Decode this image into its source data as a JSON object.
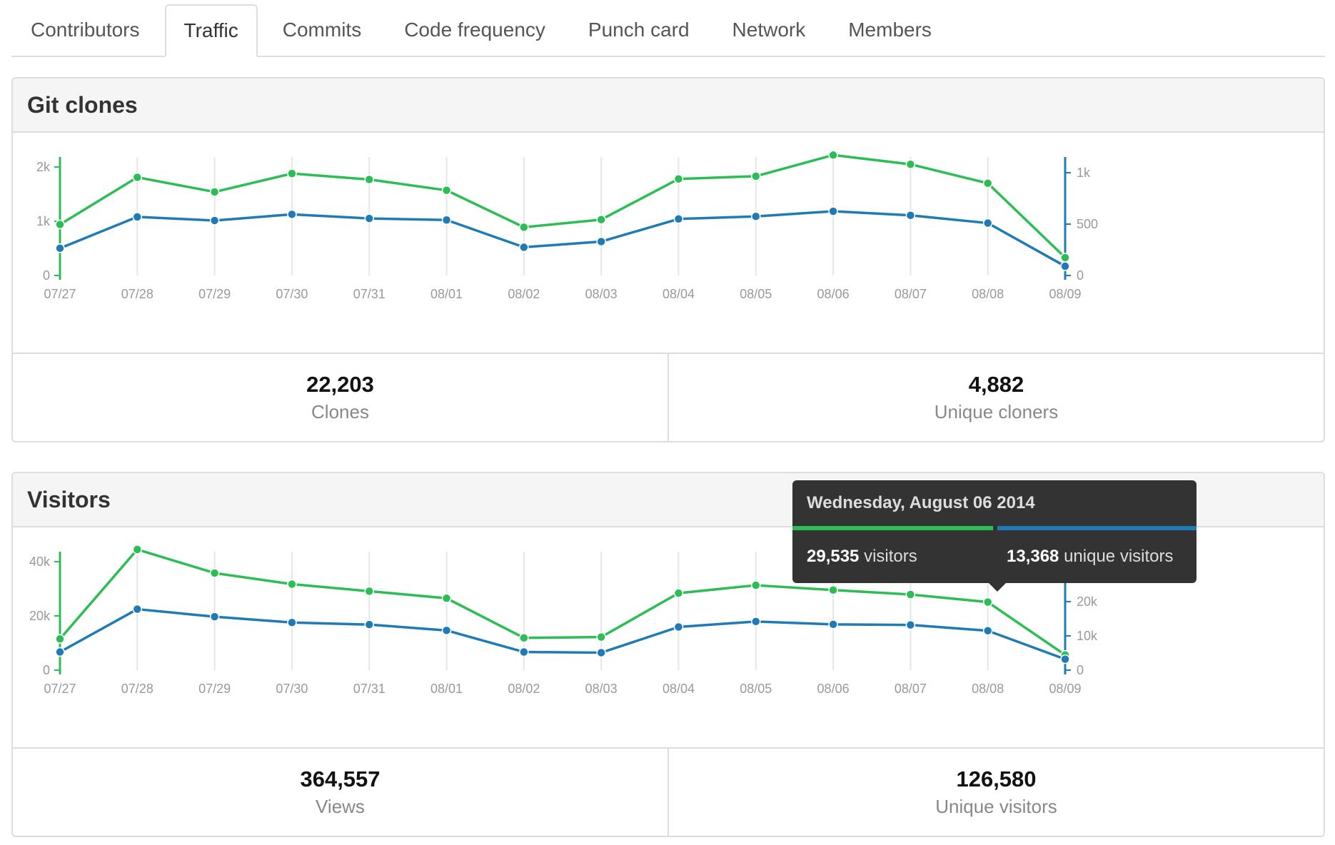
{
  "tabs": [
    {
      "label": "Contributors",
      "active": false
    },
    {
      "label": "Traffic",
      "active": true
    },
    {
      "label": "Commits",
      "active": false
    },
    {
      "label": "Code frequency",
      "active": false
    },
    {
      "label": "Punch card",
      "active": false
    },
    {
      "label": "Network",
      "active": false
    },
    {
      "label": "Members",
      "active": false
    }
  ],
  "colors": {
    "total": "#2cbd55",
    "unique": "#1f7bb5",
    "grid": "#e6e6e6",
    "axis_text": "#999999"
  },
  "clones": {
    "title": "Git clones",
    "stats": [
      {
        "value": "22,203",
        "label": "Clones"
      },
      {
        "value": "4,882",
        "label": "Unique cloners"
      }
    ]
  },
  "visitors": {
    "title": "Visitors",
    "stats": [
      {
        "value": "364,557",
        "label": "Views"
      },
      {
        "value": "126,580",
        "label": "Unique visitors"
      }
    ],
    "tooltip": {
      "date": "Wednesday, August 06 2014",
      "visitors_value": "29,535",
      "visitors_label": "visitors",
      "unique_value": "13,368",
      "unique_label": "unique visitors",
      "index": 10
    }
  },
  "chart_data": [
    {
      "type": "line",
      "title": "Git clones",
      "x": [
        "07/27",
        "07/28",
        "07/29",
        "07/30",
        "07/31",
        "08/01",
        "08/02",
        "08/03",
        "08/04",
        "08/05",
        "08/06",
        "08/07",
        "08/08",
        "08/09"
      ],
      "left_axis": {
        "ticks": [
          0,
          1000,
          2000
        ],
        "tick_labels": [
          "0",
          "1k",
          "2k"
        ],
        "ylim": [
          0,
          2000
        ]
      },
      "right_axis": {
        "ticks": [
          0,
          500,
          1000
        ],
        "tick_labels": [
          "0",
          "500",
          "1k"
        ],
        "ylim": [
          0,
          1000
        ]
      },
      "series": [
        {
          "axis": "left",
          "color": "#2cbd55",
          "values": [
            940,
            1810,
            1540,
            1880,
            1770,
            1570,
            890,
            1030,
            1780,
            1830,
            2220,
            2050,
            1700,
            330
          ]
        },
        {
          "axis": "right",
          "color": "#1f7bb5",
          "values": [
            265,
            570,
            535,
            595,
            555,
            540,
            275,
            330,
            550,
            575,
            625,
            585,
            510,
            90
          ]
        }
      ],
      "grid": true
    },
    {
      "type": "line",
      "title": "Visitors",
      "x": [
        "07/27",
        "07/28",
        "07/29",
        "07/30",
        "07/31",
        "08/01",
        "08/02",
        "08/03",
        "08/04",
        "08/05",
        "08/06",
        "08/07",
        "08/08",
        "08/09"
      ],
      "left_axis": {
        "ticks": [
          0,
          20000,
          40000
        ],
        "tick_labels": [
          "0",
          "20k",
          "40k"
        ],
        "ylim": [
          0,
          40000
        ]
      },
      "right_axis": {
        "ticks": [
          0,
          10000,
          20000,
          30000
        ],
        "tick_labels": [
          "0",
          "10k",
          "20k",
          "30k"
        ],
        "ylim": [
          0,
          30000
        ]
      },
      "series": [
        {
          "axis": "left",
          "color": "#2cbd55",
          "values": [
            11500,
            44500,
            35800,
            31700,
            29100,
            26500,
            11900,
            12200,
            28400,
            31300,
            29535,
            27900,
            25100,
            5600
          ]
        },
        {
          "axis": "right",
          "color": "#1f7bb5",
          "values": [
            5300,
            17800,
            15600,
            13900,
            13300,
            11600,
            5300,
            5100,
            12600,
            14200,
            13368,
            13200,
            11500,
            3200
          ]
        }
      ],
      "grid": true
    }
  ]
}
